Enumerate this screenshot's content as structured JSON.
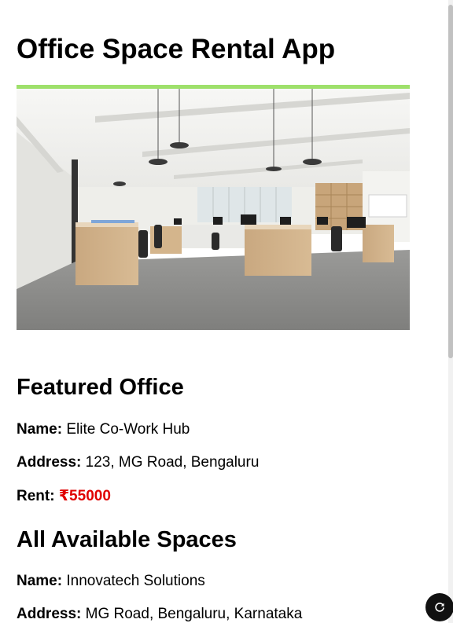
{
  "app": {
    "title": "Office Space Rental App"
  },
  "hero_image": {
    "alt": "Office interior"
  },
  "featured": {
    "heading": "Featured Office",
    "name_label": "Name:",
    "name_value": " Elite Co-Work Hub",
    "address_label": "Address:",
    "address_value": " 123, MG Road, Bengaluru",
    "rent_label": "Rent:",
    "rent_value": " ₹55000"
  },
  "all_spaces": {
    "heading": "All Available Spaces",
    "items": [
      {
        "name_label": "Name:",
        "name_value": " Innovatech Solutions",
        "address_label": "Address:",
        "address_value": " MG Road, Bengaluru, Karnataka"
      }
    ]
  },
  "colors": {
    "rent": "#e00000",
    "fab": "#111111"
  },
  "icons": {
    "fab": "refresh-icon"
  }
}
